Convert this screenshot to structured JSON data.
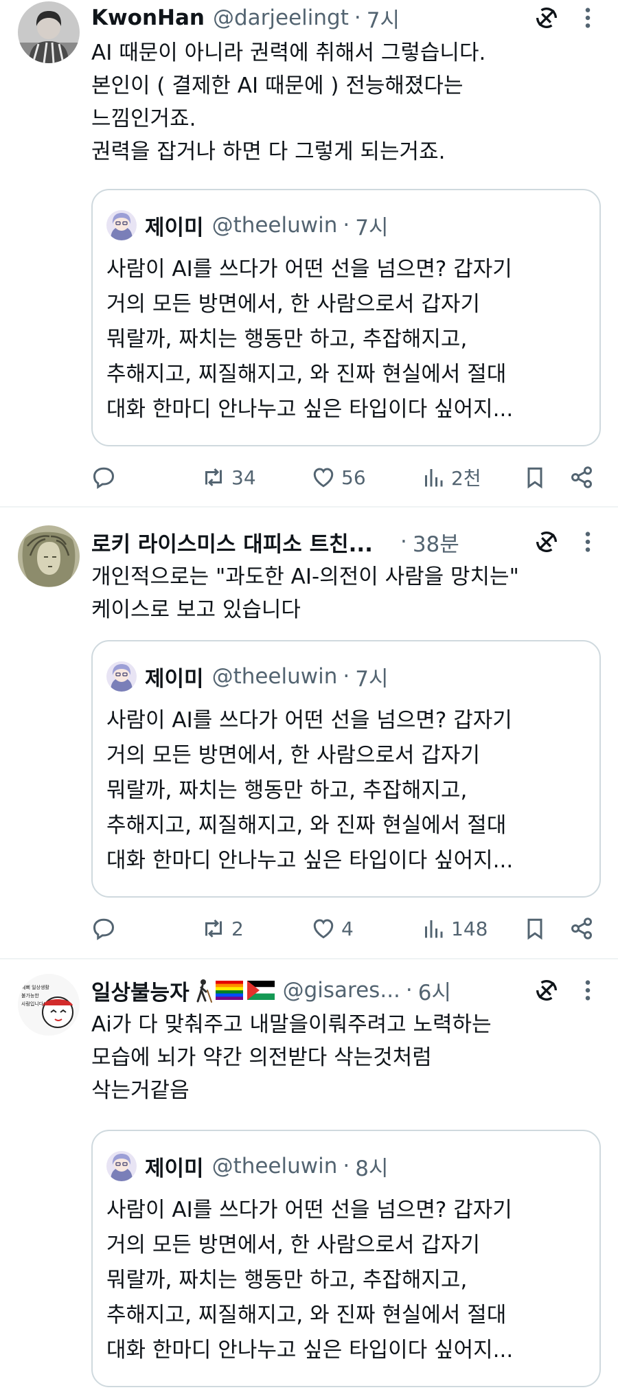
{
  "tweets": [
    {
      "display_name": "KwonHan",
      "handle": "@darjeelingt",
      "dot": "·",
      "time": "7시",
      "text": "AI 때문이 아니라 권력에 취해서 그렇습니다.\n본인이 ( 결제한 AI 때문에 ) 전능해졌다는\n느낌인거죠.\n권력을 잡거나 하면 다 그렇게 되는거죠.",
      "quote": {
        "display_name": "제이미",
        "handle": "@theeluwin",
        "dot": "·",
        "time": "7시",
        "text": "사람이 AI를 쓰다가 어떤 선을 넘으면? 갑자기\n거의 모든 방면에서, 한 사람으로서 갑자기\n뭐랄까, 짜치는 행동만 하고, 추잡해지고,\n추해지고, 찌질해지고, 와 진짜 현실에서 절대\n대화 한마디 안나누고 싶은 타입이다 싶어지..."
      },
      "actions": {
        "replies": "",
        "retweets": "34",
        "likes": "56",
        "views": "2천"
      }
    },
    {
      "display_name": "로키 라이스미스 대피소 트친...",
      "handle": "",
      "dot": "·",
      "time": "38분",
      "text": "개인적으로는 \"과도한 AI-의전이 사람을 망치는\"\n케이스로 보고 있습니다",
      "quote": {
        "display_name": "제이미",
        "handle": "@theeluwin",
        "dot": "·",
        "time": "7시",
        "text": "사람이 AI를 쓰다가 어떤 선을 넘으면? 갑자기\n거의 모든 방면에서, 한 사람으로서 갑자기\n뭐랄까, 짜치는 행동만 하고, 추잡해지고,\n추해지고, 찌질해지고, 와 진짜 현실에서 절대\n대화 한마디 안나누고 싶은 타입이다 싶어지..."
      },
      "actions": {
        "replies": "",
        "retweets": "2",
        "likes": "4",
        "views": "148"
      }
    },
    {
      "display_name": "일상불능자",
      "handle": "@gisares...",
      "dot": "·",
      "time": "6시",
      "text": "Ai가 다 맞춰주고 내말을이뤄주려고 노력하는\n모습에 뇌가 약간 의전받다 삭는것처럼\n삭는거같음",
      "avatar_caption": "예뻐 일상생활 불가능한 사람입니다!",
      "quote": {
        "display_name": "제이미",
        "handle": "@theeluwin",
        "dot": "·",
        "time": "8시",
        "text": "사람이 AI를 쓰다가 어떤 선을 넘으면? 갑자기\n거의 모든 방면에서, 한 사람으로서 갑자기\n뭐랄까, 짜치는 행동만 하고, 추잡해지고,\n추해지고, 찌질해지고, 와 진짜 현실에서 절대\n대화 한마디 안나누고 싶은 타입이다 싶어지..."
      }
    }
  ],
  "icons": {
    "reply": "reply-icon",
    "retweet": "retweet-icon",
    "like": "heart-icon",
    "views": "views-icon",
    "bookmark": "bookmark-icon",
    "share": "share-icon",
    "grok": "grok-icon",
    "more": "more-icon"
  },
  "colors": {
    "text": "#0f1419",
    "secondary": "#536471",
    "border": "#cfd9de",
    "divider": "#eff3f4"
  }
}
